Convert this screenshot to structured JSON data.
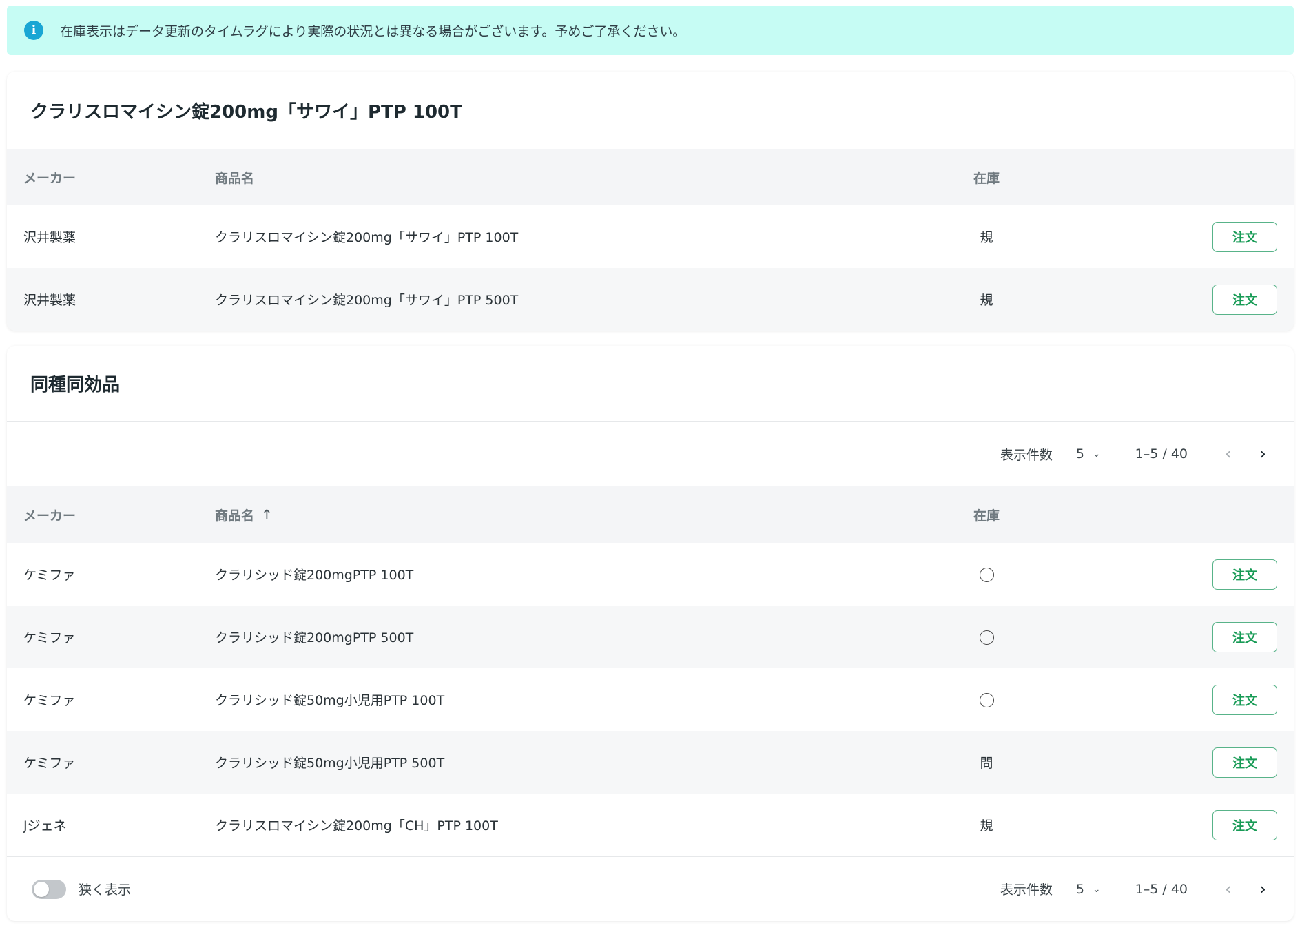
{
  "alert": {
    "icon": "info-icon",
    "message": "在庫表示はデータ更新のタイムラグにより実際の状況とは異なる場合がございます。予めご了承ください。"
  },
  "product_card": {
    "title": "クラリスロマイシン錠200mg「サワイ」PTP 100T",
    "columns": {
      "maker": "メーカー",
      "name": "商品名",
      "stock": "在庫"
    },
    "rows": [
      {
        "maker": "沢井製薬",
        "name": "クラリスロマイシン錠200mg「サワイ」PTP 100T",
        "stock": "規",
        "action": "注文"
      },
      {
        "maker": "沢井製薬",
        "name": "クラリスロマイシン錠200mg「サワイ」PTP 500T",
        "stock": "規",
        "action": "注文"
      }
    ]
  },
  "similar_card": {
    "title": "同種同効品",
    "pager_top": {
      "per_page_label": "表示件数",
      "per_page": "5",
      "range": "1–5 / 40"
    },
    "columns": {
      "maker": "メーカー",
      "name": "商品名",
      "stock": "在庫",
      "sort": "↑"
    },
    "rows": [
      {
        "maker": "ケミファ",
        "name": "クラリシッド錠200mgPTP 100T",
        "stock": "",
        "stock_icon": "circle",
        "action": "注文"
      },
      {
        "maker": "ケミファ",
        "name": "クラリシッド錠200mgPTP 500T",
        "stock": "",
        "stock_icon": "circle",
        "action": "注文"
      },
      {
        "maker": "ケミファ",
        "name": "クラリシッド錠50mg小児用PTP 100T",
        "stock": "",
        "stock_icon": "circle",
        "action": "注文"
      },
      {
        "maker": "ケミファ",
        "name": "クラリシッド錠50mg小児用PTP 500T",
        "stock": "問",
        "action": "注文"
      },
      {
        "maker": "Jジェネ",
        "name": "クラリスロマイシン錠200mg「CH」PTP 100T",
        "stock": "規",
        "action": "注文"
      }
    ],
    "footer": {
      "dense_label": "狭く表示",
      "dense_on": false,
      "pager": {
        "per_page_label": "表示件数",
        "per_page": "5",
        "range": "1–5 / 40"
      }
    }
  },
  "colors": {
    "alert_bg": "#c6fcf4",
    "info_icon": "#19a6d4",
    "order_button": "#189b56",
    "table_header_bg": "#f4f5f7"
  }
}
